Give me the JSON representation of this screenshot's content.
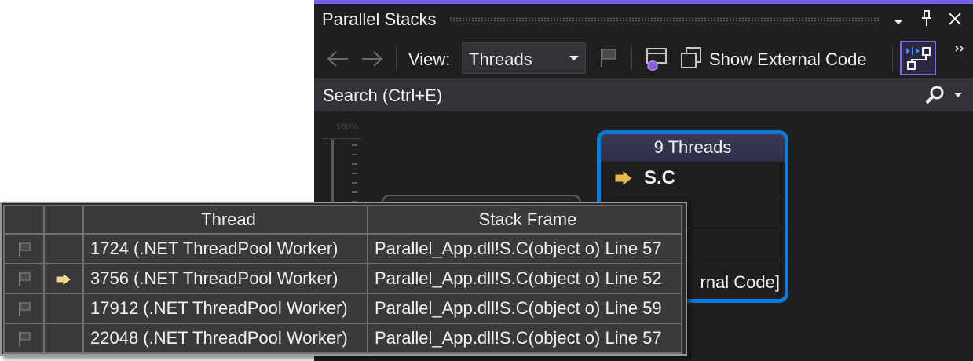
{
  "window": {
    "title": "Parallel Stacks",
    "title_icons": [
      "chevron-down-icon",
      "pin-icon",
      "close-icon"
    ]
  },
  "toolbar": {
    "view_label": "View:",
    "view_value": "Threads",
    "show_external_code": "Show External Code"
  },
  "search": {
    "placeholder": "Search (Ctrl+E)"
  },
  "canvas": {
    "zoom_label": "100%",
    "thread_node": {
      "header": "9 Threads",
      "frame": "S.C",
      "external_code": "rnal Code]"
    }
  },
  "threads_tooltip": {
    "columns": [
      "",
      "",
      "Thread",
      "Stack Frame"
    ],
    "rows": [
      {
        "thread": "1724 (.NET ThreadPool Worker)",
        "frame": "Parallel_App.dll!S.C(object o) Line 57",
        "current": false
      },
      {
        "thread": "3756 (.NET ThreadPool Worker)",
        "frame": "Parallel_App.dll!S.C(object o) Line 52",
        "current": true
      },
      {
        "thread": "17912 (.NET ThreadPool Worker)",
        "frame": "Parallel_App.dll!S.C(object o) Line 59",
        "current": false
      },
      {
        "thread": "22048 (.NET ThreadPool Worker)",
        "frame": "Parallel_App.dll!S.C(object o) Line 57",
        "current": false
      }
    ]
  },
  "colors": {
    "accent": "#7160e8",
    "node_border": "#0f7bd8",
    "current_arrow": "#e6b94a"
  }
}
